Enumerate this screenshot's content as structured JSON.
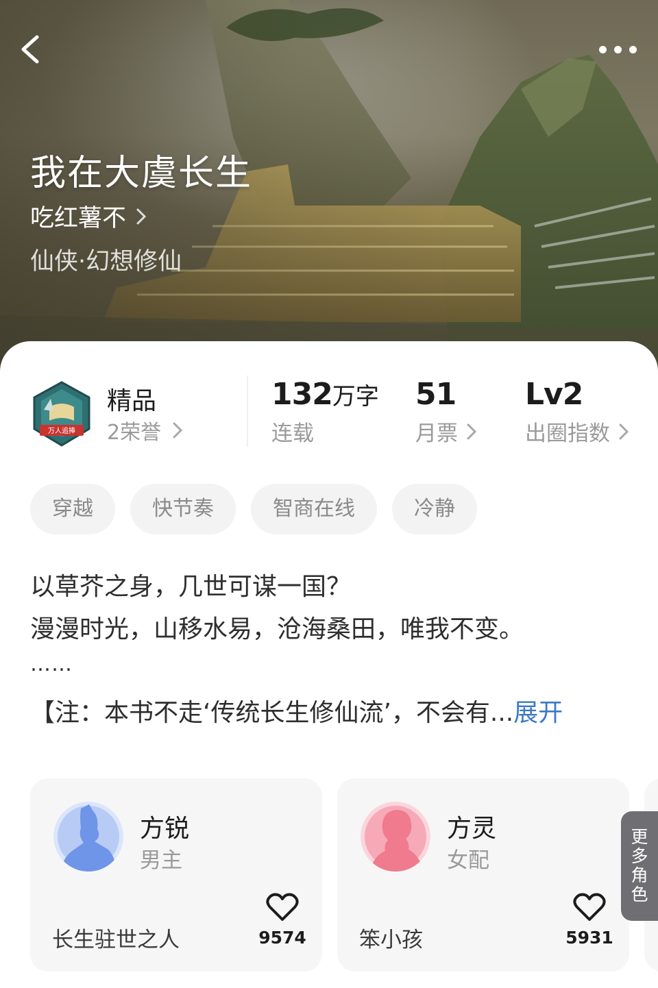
{
  "header": {
    "title": "我在大虞长生",
    "author": "吃红薯不",
    "genre": "仙侠·幻想修仙"
  },
  "quality": {
    "badge_text": "万人追捧",
    "title": "精品",
    "honors": "2荣誉"
  },
  "stats": [
    {
      "value": "132",
      "unit": "万字",
      "label": "连载",
      "has_arrow": false
    },
    {
      "value": "51",
      "unit": "",
      "label": "月票",
      "has_arrow": true
    },
    {
      "value": "Lv2",
      "unit": "",
      "label": "出圈指数",
      "has_arrow": true
    }
  ],
  "tags": [
    "穿越",
    "快节奏",
    "智商在线",
    "冷静"
  ],
  "intro": {
    "lines": [
      "以草芥之身，几世可谋一国？",
      "漫漫时光，山移水易，沧海桑田，唯我不变。"
    ],
    "ellipsis": "……",
    "note": "【注：本书不走‘传统长生修仙流’，不会有...",
    "expand": "展开"
  },
  "characters": [
    {
      "name": "方锐",
      "role": "男主",
      "desc": "长生驻世之人",
      "likes": "9574",
      "color": "#6f95e8"
    },
    {
      "name": "方灵",
      "role": "女配",
      "desc": "笨小孩",
      "likes": "5931",
      "color": "#f07a8e"
    }
  ],
  "more_roles": [
    "更",
    "多",
    "角",
    "色"
  ],
  "icons": [
    "back-arrow-icon",
    "more-dots-icon",
    "chevron-right-icon",
    "heart-icon",
    "quality-badge-icon"
  ]
}
